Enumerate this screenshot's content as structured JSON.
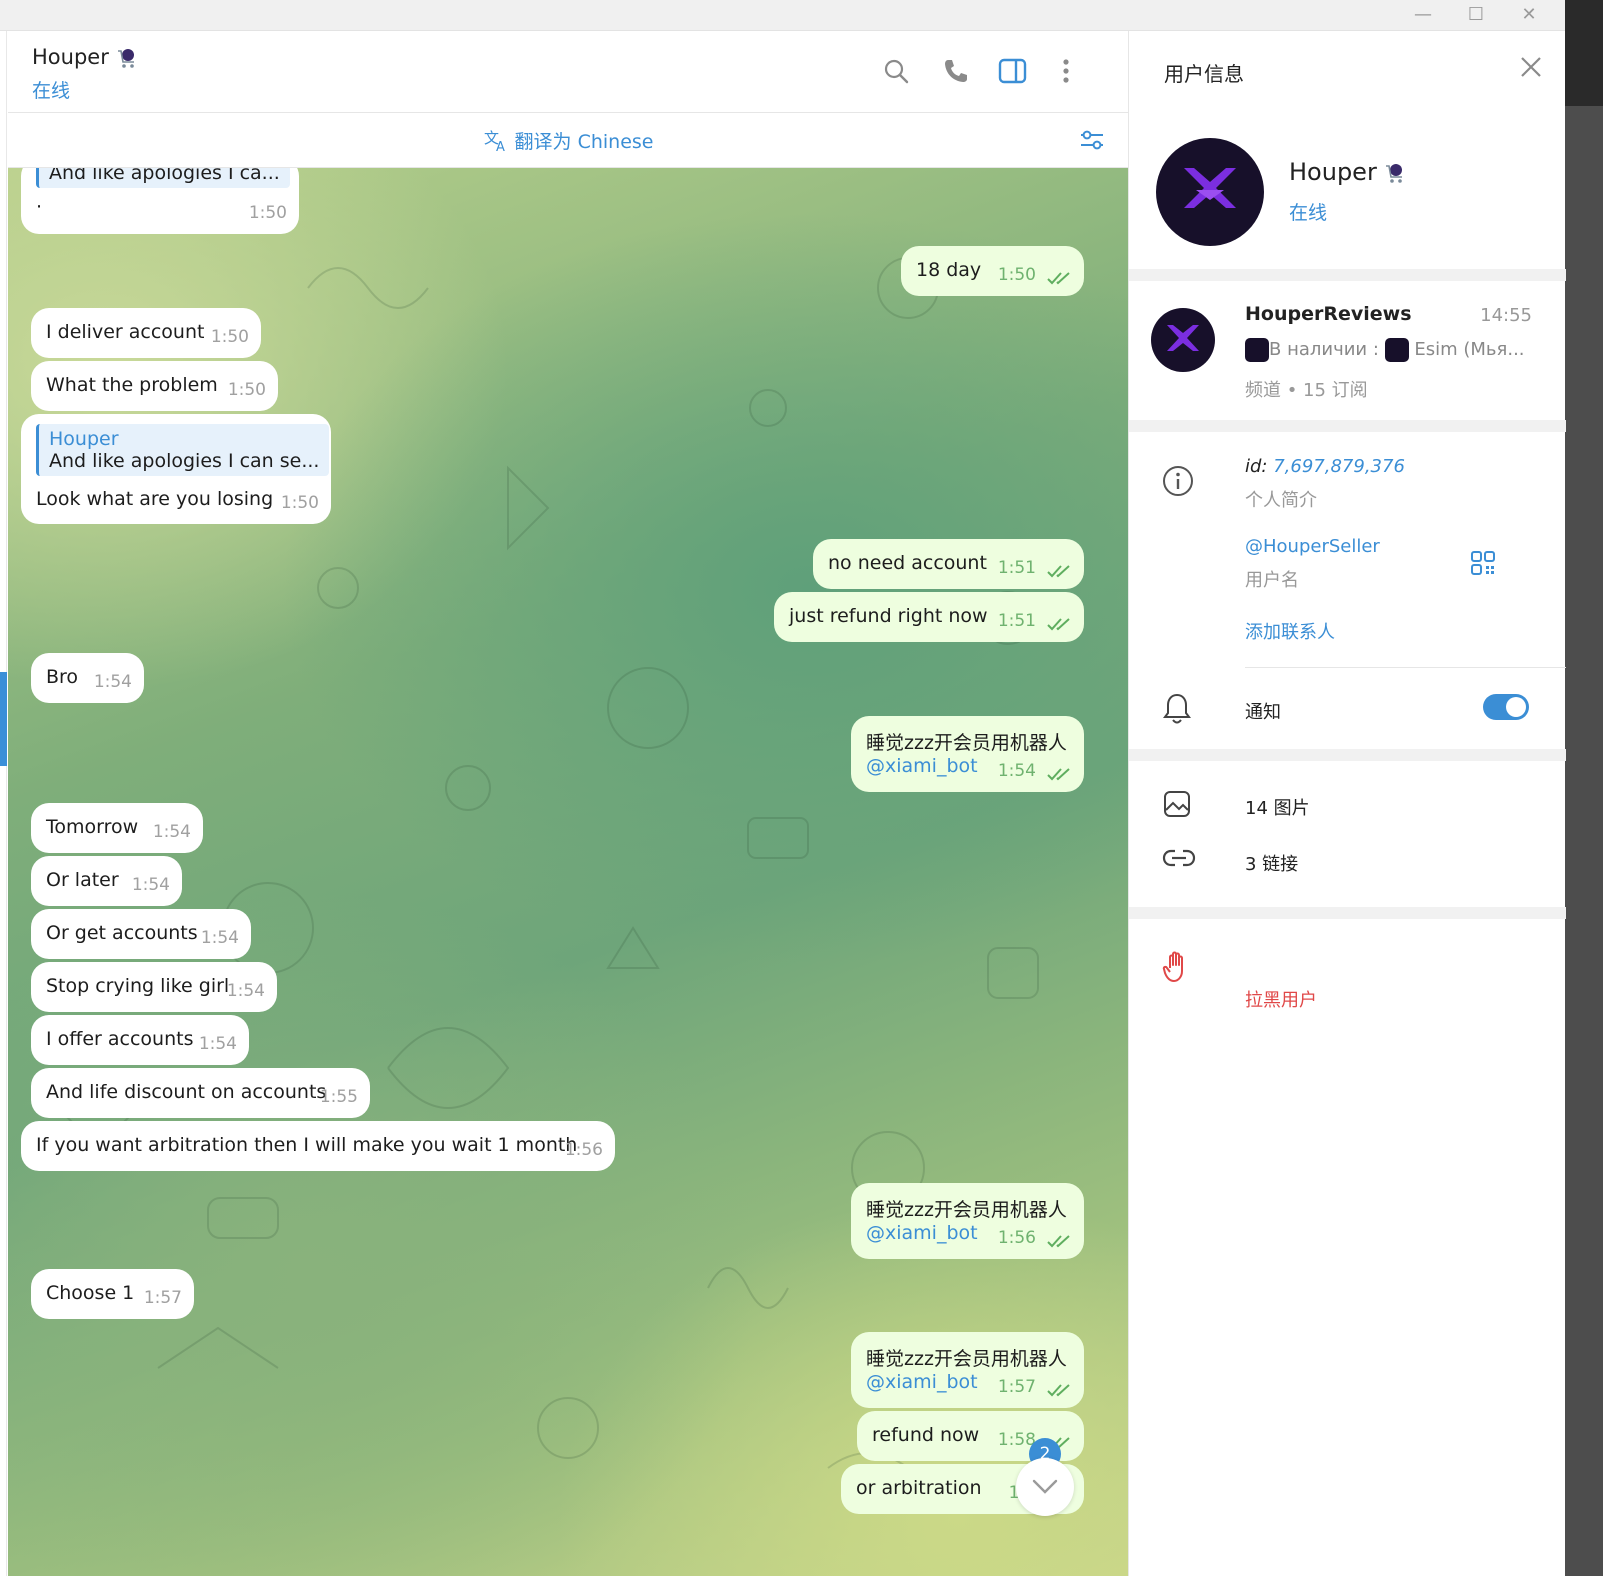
{
  "window": {
    "minimize_label": "—",
    "maximize_label": "☐",
    "close_label": "✕"
  },
  "chat_header": {
    "name": "Houper",
    "status": "在线",
    "icons": [
      "search-icon",
      "phone-icon",
      "sidebar-toggle-icon",
      "more-vertical-icon"
    ]
  },
  "translate_bar": {
    "label": "翻译为 Chinese",
    "icon": "translate-icon"
  },
  "messages": [
    {
      "dir": "in",
      "reply_text": "And like apologies I ca...",
      "text": "·",
      "time": "1:50"
    },
    {
      "dir": "out",
      "text": "18 day",
      "time": "1:50"
    },
    {
      "dir": "in",
      "text": "I deliver account",
      "time": "1:50"
    },
    {
      "dir": "in",
      "text": "What the problem",
      "time": "1:50"
    },
    {
      "dir": "in",
      "reply_name": "Houper",
      "reply_text": "And like apologies I can se...",
      "text": "Look what are you losing",
      "time": "1:50"
    },
    {
      "dir": "out",
      "text": "no need account",
      "time": "1:51"
    },
    {
      "dir": "out",
      "text": "just refund right now",
      "time": "1:51"
    },
    {
      "dir": "in",
      "text": "Bro",
      "time": "1:54"
    },
    {
      "dir": "out",
      "text": "睡觉zzz开会员用机器人",
      "bot": "@xiami_bot",
      "time": "1:54"
    },
    {
      "dir": "in",
      "text": "Tomorrow",
      "time": "1:54"
    },
    {
      "dir": "in",
      "text": "Or later",
      "time": "1:54"
    },
    {
      "dir": "in",
      "text": "Or get accounts",
      "time": "1:54"
    },
    {
      "dir": "in",
      "text": "Stop crying like girl",
      "time": "1:54"
    },
    {
      "dir": "in",
      "text": "I offer accounts",
      "time": "1:54"
    },
    {
      "dir": "in",
      "text": "And life discount on accounts",
      "time": "1:55"
    },
    {
      "dir": "in",
      "text": "If you want arbitration then I will make you wait 1 month",
      "time": "1:56"
    },
    {
      "dir": "out",
      "text": "睡觉zzz开会员用机器人",
      "bot": "@xiami_bot",
      "time": "1:56"
    },
    {
      "dir": "in",
      "text": "Choose 1",
      "time": "1:57"
    },
    {
      "dir": "out",
      "text": "睡觉zzz开会员用机器人",
      "bot": "@xiami_bot",
      "time": "1:57"
    },
    {
      "dir": "out",
      "text": "refund now",
      "time": "1:58"
    },
    {
      "dir": "out",
      "text": "or arbitration",
      "time": "1:5"
    }
  ],
  "unread_count": "2",
  "user_info": {
    "title": "用户信息",
    "name": "Houper",
    "status": "在线",
    "channel": {
      "name": "HouperReviews",
      "time": "14:55",
      "preview_a": "В наличии :",
      "preview_b": "Esim (Мья...",
      "meta": "频道 • 15 订阅"
    },
    "id_prefix": "id: ",
    "id_value": "7,697,879,376",
    "bio_label": "个人简介",
    "username": "@HouperSeller",
    "username_label": "用户名",
    "add_contact": "添加联系人",
    "notifications_label": "通知",
    "notifications_on": true,
    "photos": "14 图片",
    "links": "3 链接",
    "block": "拉黑用户"
  },
  "colors": {
    "accent": "#3b8ed5",
    "outgoing_bubble": "#eefedf",
    "danger": "#e04848"
  }
}
